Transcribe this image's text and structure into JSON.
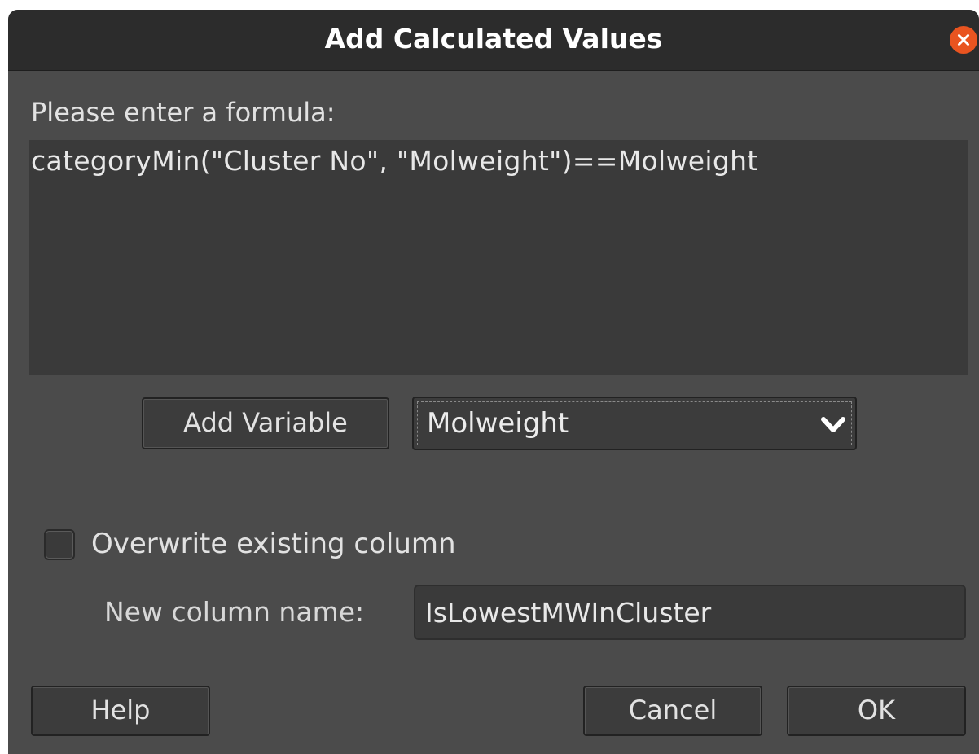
{
  "dialog": {
    "title": "Add Calculated Values",
    "close_icon": "close-icon"
  },
  "formula": {
    "prompt": "Please enter a formula:",
    "value": "categoryMin(\"Cluster No\", \"Molweight\")==Molweight"
  },
  "variable": {
    "add_button_label": "Add Variable",
    "selected": "Molweight",
    "dropdown_icon": "chevron-down-icon"
  },
  "overwrite": {
    "label": "Overwrite existing column",
    "checked": false
  },
  "new_column": {
    "label": "New column name:",
    "value": "IsLowestMWInCluster"
  },
  "buttons": {
    "help": "Help",
    "cancel": "Cancel",
    "ok": "OK"
  },
  "colors": {
    "title_bar": "#2c2c2c",
    "dialog_bg": "#4b4b4b",
    "close_accent": "#e95420"
  }
}
